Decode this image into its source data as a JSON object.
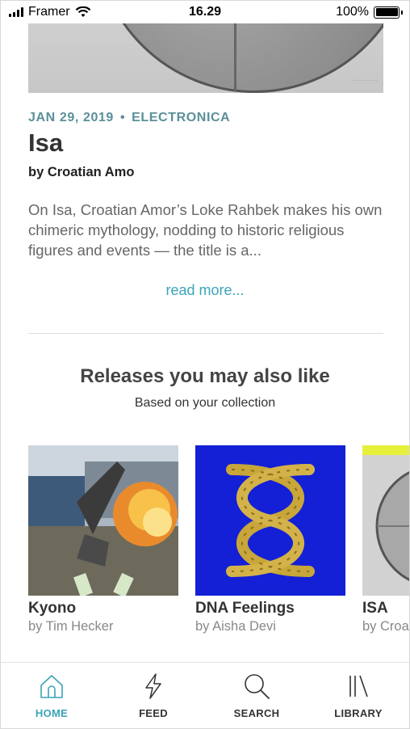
{
  "status_bar": {
    "carrier": "Framer",
    "time": "16.29",
    "battery": "100%"
  },
  "article": {
    "date": "JAN 29, 2019",
    "genre": "ELECTRONICA",
    "title": "Isa",
    "byline": "by Croatian Amo",
    "description": "On Isa, Croatian Amor’s Loke Rahbek makes his own chimeric mythology, nodding to historic religious figures and events — the title is a...",
    "read_more": "read more..."
  },
  "recommendations": {
    "title": "Releases you may also like",
    "subtitle": "Based on your collection",
    "items": [
      {
        "name": "Kyono",
        "artist": "by Tim Hecker"
      },
      {
        "name": "DNA Feelings",
        "artist": "by Aisha Devi"
      },
      {
        "name": "ISA",
        "artist": "by Croatian Amor"
      }
    ]
  },
  "tabs": [
    {
      "label": "HOME",
      "icon": "home-icon",
      "active": true
    },
    {
      "label": "FEED",
      "icon": "lightning-icon",
      "active": false
    },
    {
      "label": "SEARCH",
      "icon": "search-icon",
      "active": false
    },
    {
      "label": "LIBRARY",
      "icon": "library-icon",
      "active": false
    }
  ],
  "colors": {
    "accent": "#3ba4b8",
    "meta": "#5a8f99",
    "dna_cover_bg": "#1320d6",
    "dna_gold": "#c8a63a"
  }
}
